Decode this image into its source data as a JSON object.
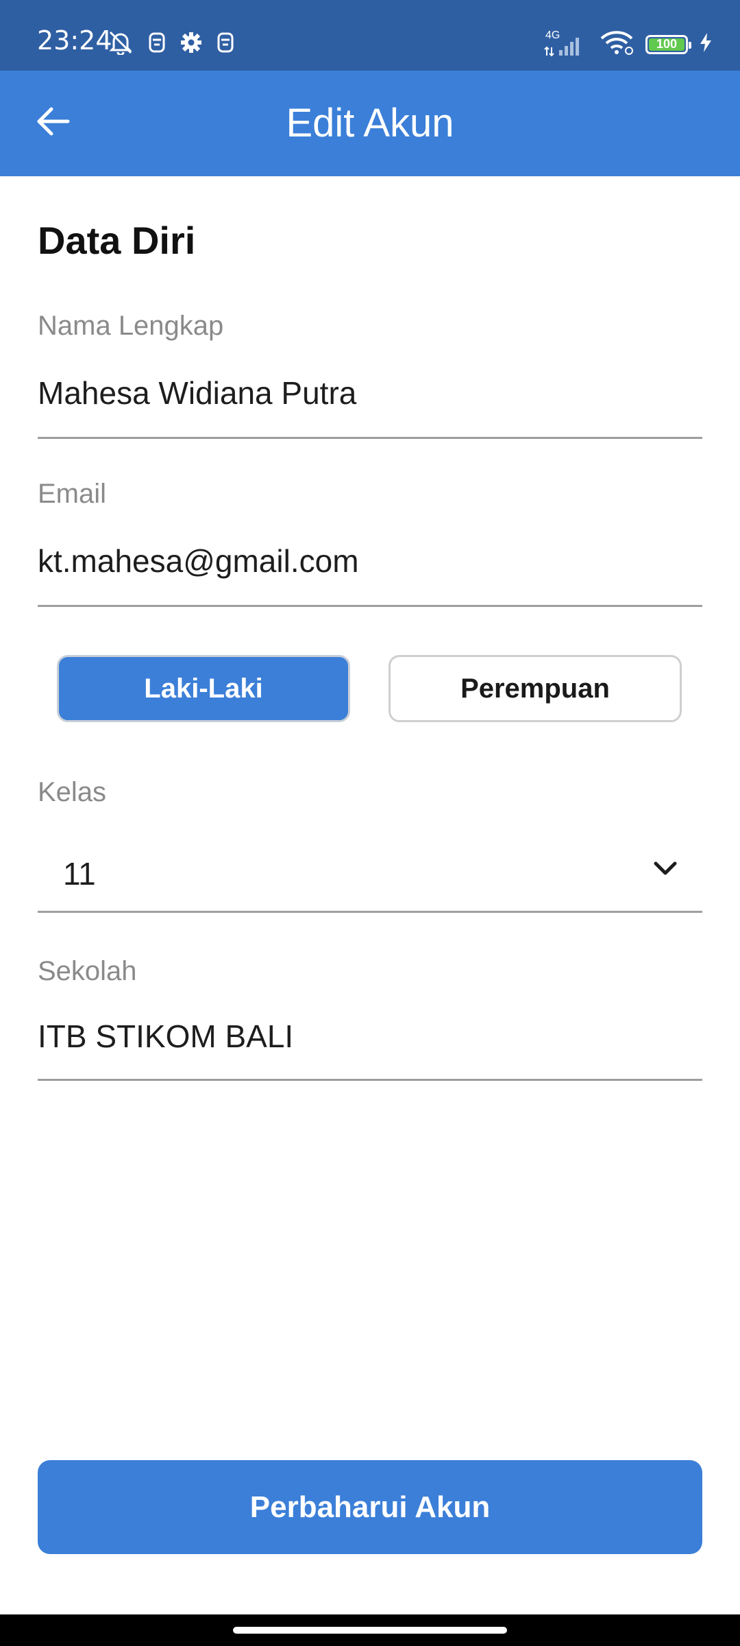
{
  "status_bar": {
    "time": "23:24",
    "network_label": "4G",
    "battery_level": "100",
    "icons_left": [
      "bell-off-icon",
      "notification-icon",
      "gear-icon",
      "notification-icon"
    ],
    "icons_right": [
      "signal-icon",
      "wifi-icon",
      "battery-icon",
      "charging-icon"
    ]
  },
  "app_bar": {
    "title": "Edit Akun",
    "back_icon": "arrow-left-icon"
  },
  "form": {
    "section_title": "Data Diri",
    "full_name": {
      "label": "Nama Lengkap",
      "value": "Mahesa Widiana Putra"
    },
    "email": {
      "label": "Email",
      "value": "kt.mahesa@gmail.com"
    },
    "gender": {
      "options": [
        "Laki-Laki",
        "Perempuan"
      ],
      "selected": "Laki-Laki"
    },
    "class": {
      "label": "Kelas",
      "value": "11"
    },
    "school": {
      "label": "Sekolah",
      "value": "ITB STIKOM BALI"
    }
  },
  "actions": {
    "submit_label": "Perbaharui Akun"
  },
  "colors": {
    "status_bar": "#2f5fa3",
    "primary": "#3b7fd8",
    "label_gray": "#8a8a8a",
    "line_gray": "#9e9e9e"
  }
}
